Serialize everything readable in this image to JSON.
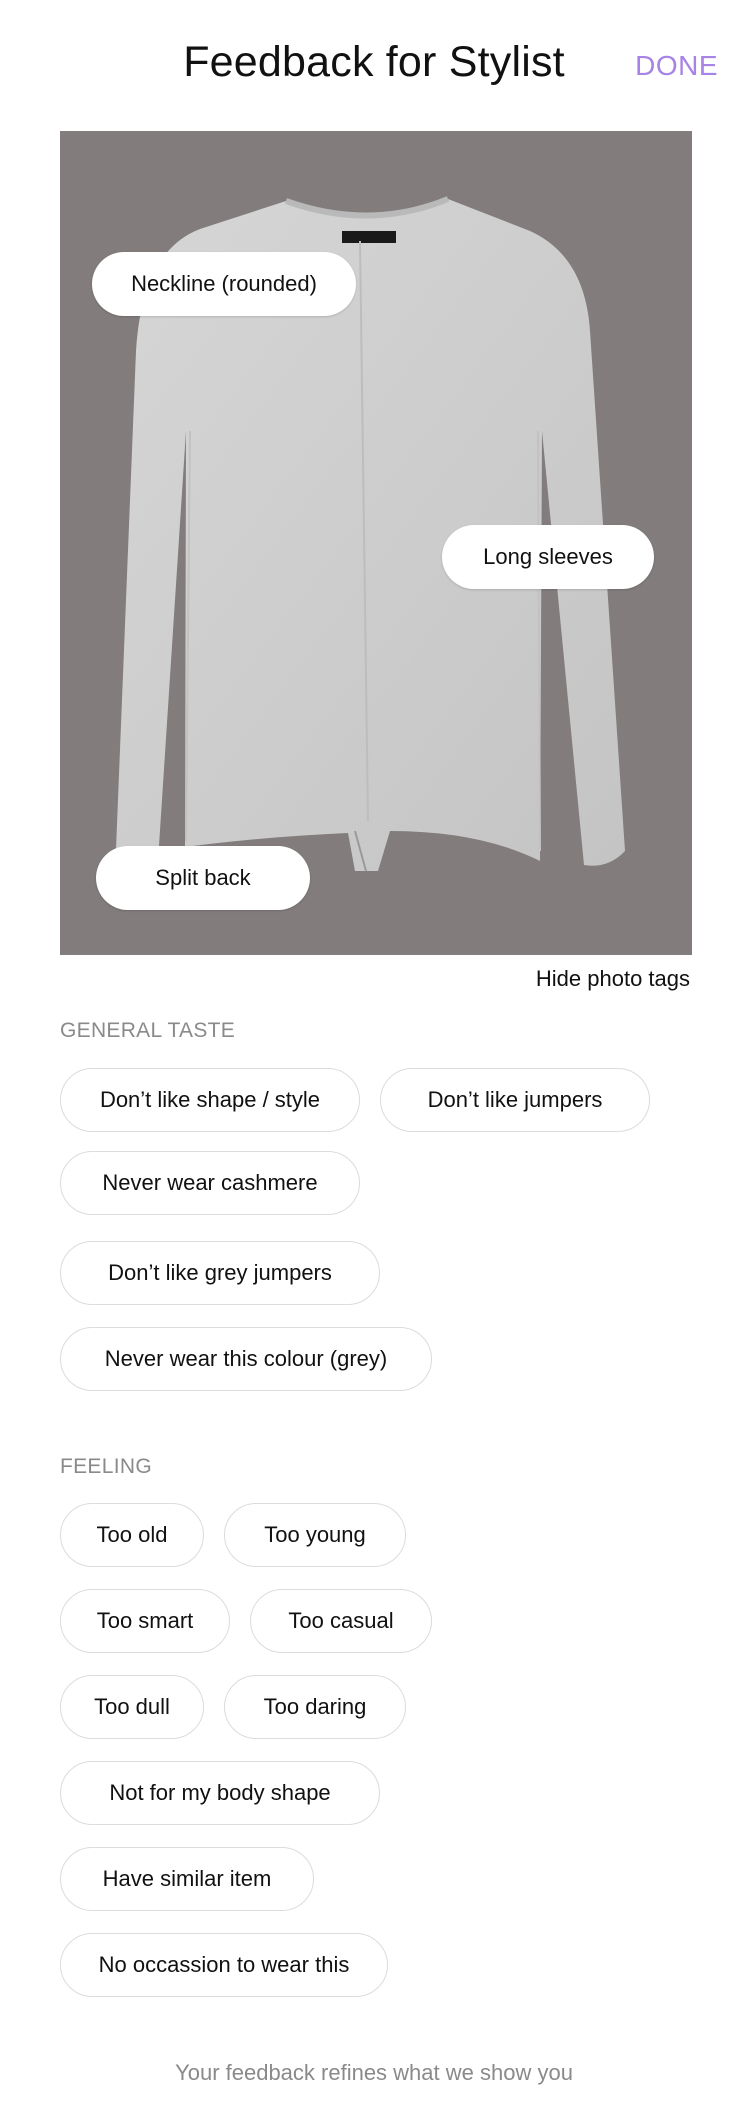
{
  "header": {
    "title": "Feedback for Stylist",
    "done_label": "DONE"
  },
  "photo": {
    "tags": [
      "Neckline (rounded)",
      "Long sleeves",
      "Split back"
    ],
    "hide_tags_label": "Hide photo tags"
  },
  "general_taste": {
    "title": "GENERAL TASTE",
    "options": [
      "Don’t like shape / style",
      "Don’t like jumpers",
      "Never wear cashmere",
      "Don’t like grey jumpers",
      "Never wear this colour (grey)"
    ]
  },
  "feeling": {
    "title": "FEELING",
    "options": [
      "Too old",
      "Too young",
      "Too smart",
      "Too casual",
      "Too dull",
      "Too daring",
      "Not for my body shape",
      "Have similar item",
      "No occassion to wear this"
    ]
  },
  "footer": {
    "text": "Your feedback refines what we show you"
  },
  "colors": {
    "accent": "#a783e6",
    "photo_background": "#827c7c",
    "sweater": "#cfcfcf"
  }
}
